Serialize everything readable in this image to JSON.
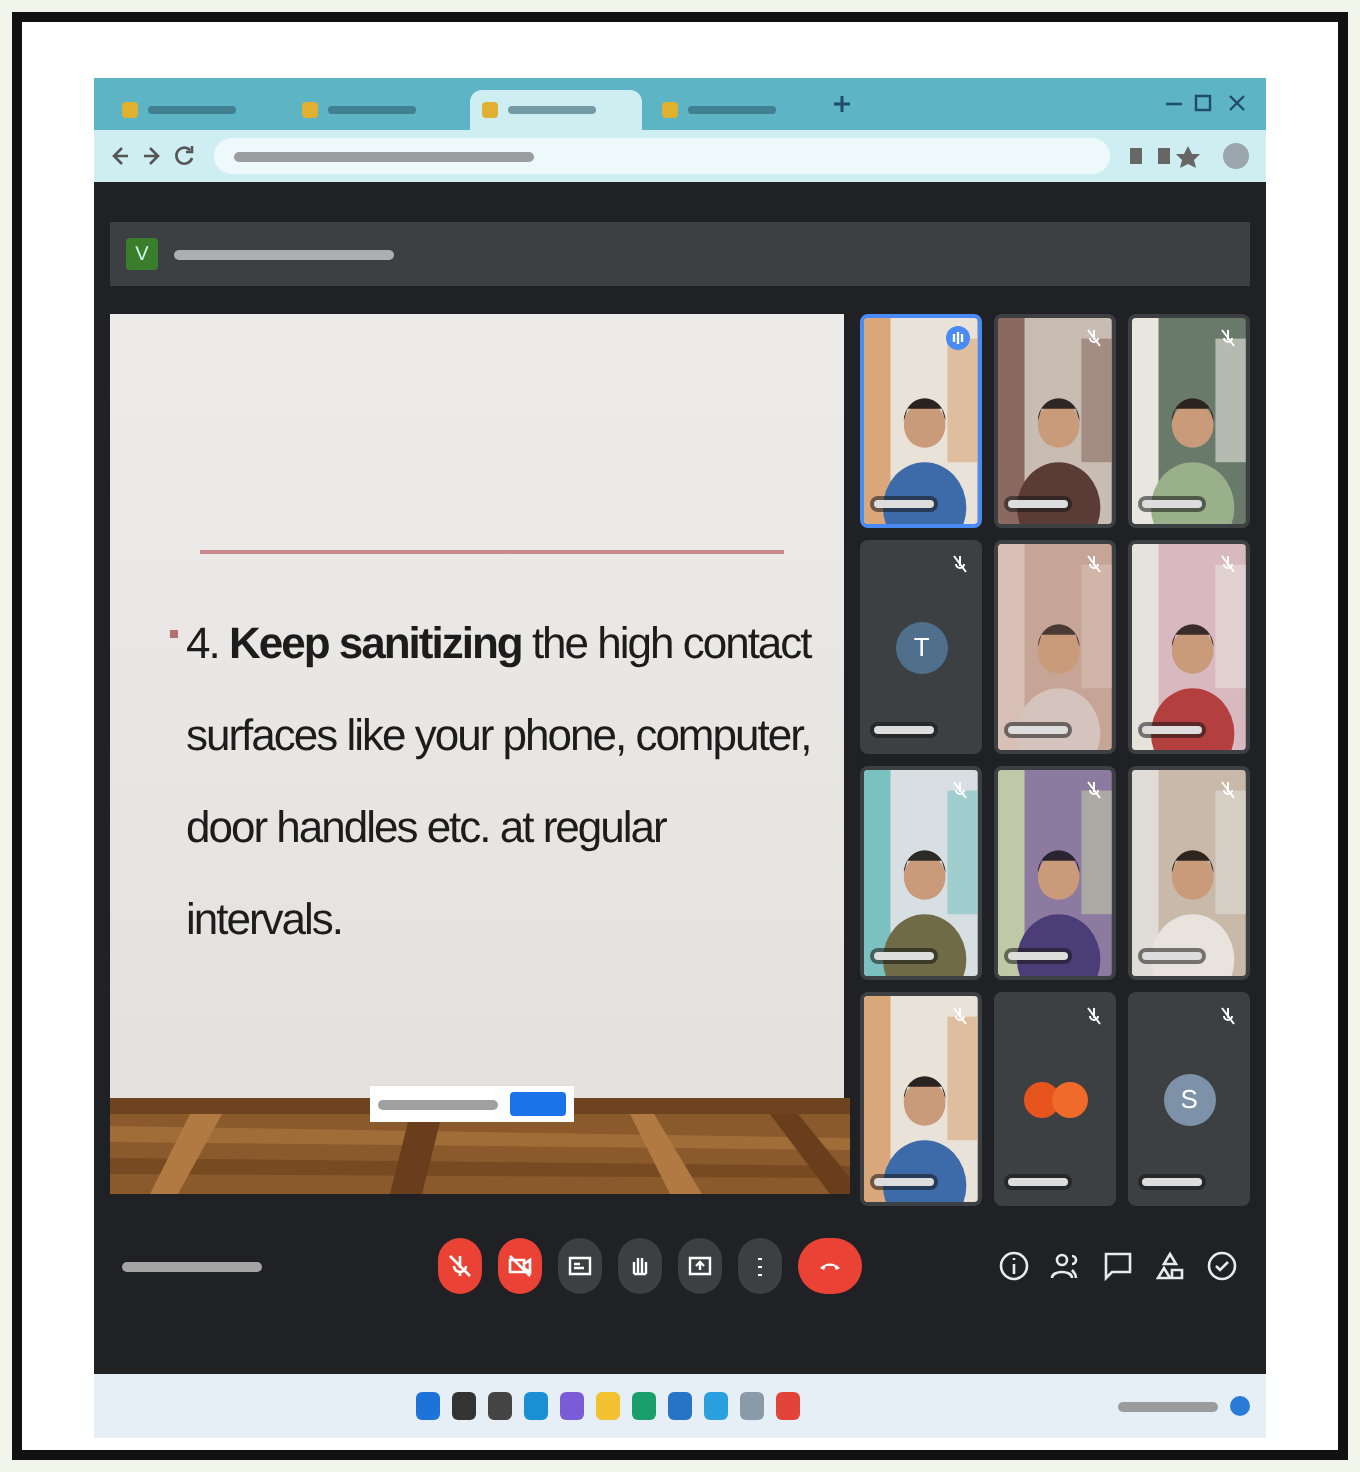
{
  "browser": {
    "tabs": [
      {
        "selected": false
      },
      {
        "selected": false
      },
      {
        "selected": true
      },
      {
        "selected": false
      }
    ]
  },
  "meeting": {
    "presenter_banner": {
      "avatar_letter": "V"
    },
    "slide": {
      "bullet": true,
      "text": "4. **Keep sanitizing** the high contact surfaces like your phone, computer, door handles etc. at regular intervals.",
      "floor": {
        "kind": "picture"
      }
    },
    "participants": [
      {
        "kind": "picture",
        "speaking": true
      },
      {
        "kind": "picture",
        "speaking": false
      },
      {
        "kind": "picture",
        "speaking": false
      },
      {
        "kind": "avatar",
        "letter": "T",
        "color": "#4f6f8c",
        "speaking": false
      },
      {
        "kind": "picture",
        "speaking": false
      },
      {
        "kind": "picture",
        "speaking": false
      },
      {
        "kind": "picture",
        "speaking": false
      },
      {
        "kind": "picture",
        "speaking": false
      },
      {
        "kind": "picture",
        "speaking": false
      },
      {
        "kind": "picture",
        "speaking": false
      },
      {
        "kind": "others",
        "speaking": false
      },
      {
        "kind": "avatar",
        "letter": "S",
        "color": "#7d92a8",
        "speaking": false
      }
    ],
    "controls": [
      {
        "kind": "mic",
        "off": true
      },
      {
        "kind": "camera",
        "off": true
      },
      {
        "kind": "captions",
        "off": false
      },
      {
        "kind": "hand",
        "off": false
      },
      {
        "kind": "present",
        "off": false
      },
      {
        "kind": "more",
        "off": false
      },
      {
        "kind": "leave"
      }
    ],
    "side_controls": [
      {
        "kind": "info"
      },
      {
        "kind": "people"
      },
      {
        "kind": "chat"
      },
      {
        "kind": "activities"
      },
      {
        "kind": "host"
      }
    ]
  },
  "taskbar": {
    "apps": [
      {
        "color": "#1e73d8"
      },
      {
        "color": "#333333"
      },
      {
        "color": "#444444"
      },
      {
        "color": "#1a8fd6"
      },
      {
        "color": "#7b5cd6"
      },
      {
        "color": "#f2c230"
      },
      {
        "color": "#1a9f6a"
      },
      {
        "color": "#2674c8"
      },
      {
        "color": "#2aa0e0"
      },
      {
        "color": "#8a9aa8"
      },
      {
        "color": "#e2443a"
      }
    ]
  }
}
